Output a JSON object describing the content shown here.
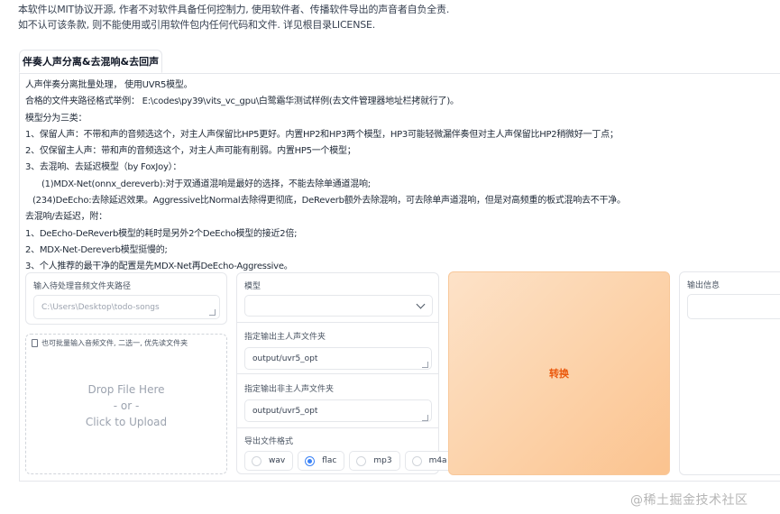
{
  "notice": {
    "line1": "本软件以MIT协议开源, 作者不对软件具备任何控制力, 使用软件者、传播软件导出的声音者自负全责.",
    "line2": "如不认可该条款, 则不能使用或引用软件包内任何代码和文件. 详见根目录LICENSE."
  },
  "tab": {
    "label": "伴奏人声分离&去混响&去回声"
  },
  "description": [
    "人声伴奏分离批量处理， 使用UVR5模型。",
    "合格的文件夹路径格式举例： E:\\codes\\py39\\vits_vc_gpu\\白鹭霜华测试样例(去文件管理器地址栏拷就行了)。",
    "模型分为三类：",
    "1、保留人声：不带和声的音频选这个，对主人声保留比HP5更好。内置HP2和HP3两个模型，HP3可能轻微漏伴奏但对主人声保留比HP2稍微好一丁点；",
    "2、仅保留主人声：带和声的音频选这个，对主人声可能有削弱。内置HP5一个模型；",
    "3、去混响、去延迟模型（by FoxJoy）：",
    "(1)MDX-Net(onnx_dereverb):对于双通道混响是最好的选择，不能去除单通道混响;",
    "(234)DeEcho:去除延迟效果。Aggressive比Normal去除得更彻底，DeReverb额外去除混响，可去除单声道混响，但是对高频重的板式混响去不干净。",
    "去混响/去延迟，附：",
    "1、DeEcho-DeReverb模型的耗时是另外2个DeEcho模型的接近2倍;",
    "2、MDX-Net-Dereverb模型挺慢的;",
    "3、个人推荐的最干净的配置是先MDX-Net再DeEcho-Aggressive。"
  ],
  "input_dir": {
    "label": "输入待处理音频文件夹路径",
    "placeholder": "C:\\Users\\Desktop\\todo-songs"
  },
  "upload": {
    "label": "也可批量输入音频文件, 二选一, 优先读文件夹",
    "drop_text": "Drop File Here",
    "or_text": "- or -",
    "click_text": "Click to Upload"
  },
  "model": {
    "label": "模型",
    "value": ""
  },
  "vocal_out": {
    "label": "指定输出主人声文件夹",
    "value": "output/uvr5_opt"
  },
  "ins_out": {
    "label": "指定输出非主人声文件夹",
    "value": "output/uvr5_opt"
  },
  "format": {
    "label": "导出文件格式",
    "options": [
      "wav",
      "flac",
      "mp3",
      "m4a"
    ],
    "selected": "flac"
  },
  "convert_button": {
    "label": "转换"
  },
  "output_info": {
    "label": "输出信息",
    "value": ""
  },
  "watermark": "@稀土掘金技术社区",
  "colors": {
    "accent": "#ea580c",
    "button_bg": "#fcd3ab",
    "radio_selected": "#3b82f6"
  }
}
